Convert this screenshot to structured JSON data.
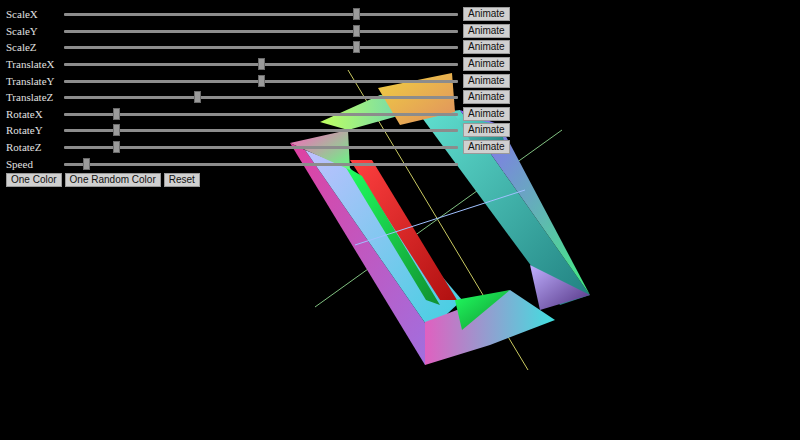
{
  "sliders": [
    {
      "label": "ScaleX",
      "kind": "animated",
      "level": 0.746,
      "button": "Animate"
    },
    {
      "label": "ScaleY",
      "kind": "animated",
      "level": 0.746,
      "button": "Animate"
    },
    {
      "label": "ScaleZ",
      "kind": "animated",
      "level": 0.746,
      "button": "Animate"
    },
    {
      "label": "TranslateX",
      "kind": "animated",
      "level": 0.5,
      "button": "Animate"
    },
    {
      "label": "TranslateY",
      "kind": "animated",
      "level": 0.5,
      "button": "Animate"
    },
    {
      "label": "TranslateZ",
      "kind": "animated",
      "level": 0.337,
      "button": "Animate"
    },
    {
      "label": "RotateX",
      "kind": "animated",
      "level": 0.127,
      "button": "Animate"
    },
    {
      "label": "RotateY",
      "kind": "animated",
      "level": 0.127,
      "button": "Animate"
    },
    {
      "label": "RotateZ",
      "kind": "animated",
      "level": 0.127,
      "button": "Animate"
    },
    {
      "label": "Speed",
      "kind": "plain",
      "level": 0.048
    }
  ],
  "buttons": [
    "One Color",
    "One Random Color",
    "Reset"
  ]
}
